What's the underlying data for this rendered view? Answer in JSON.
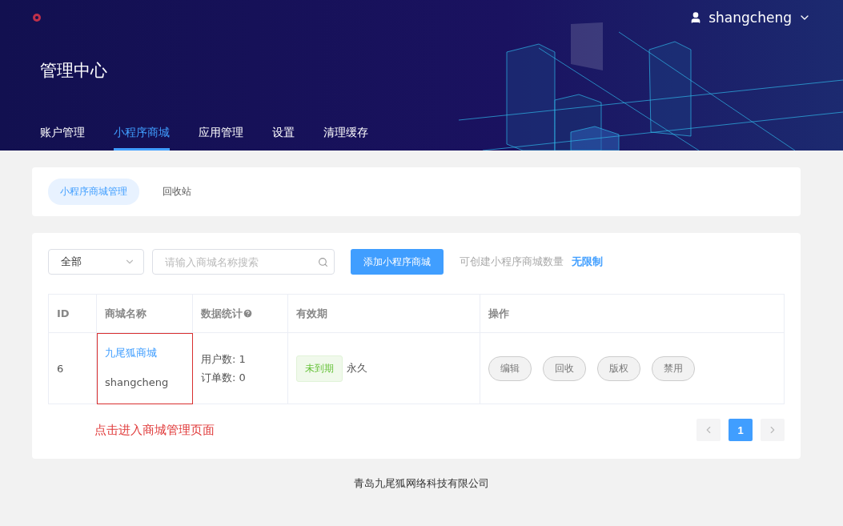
{
  "header": {
    "user": "shangcheng",
    "title": "管理中心",
    "nav": [
      {
        "label": "账户管理",
        "selected": false
      },
      {
        "label": "小程序商城",
        "selected": true
      },
      {
        "label": "应用管理",
        "selected": false
      },
      {
        "label": "设置",
        "selected": false
      },
      {
        "label": "清理缓存",
        "selected": false
      }
    ]
  },
  "subtabs": [
    {
      "label": "小程序商城管理",
      "selected": true
    },
    {
      "label": "回收站",
      "selected": false
    }
  ],
  "toolbar": {
    "filter": "全部",
    "search_placeholder": "请输入商城名称搜索",
    "add_button": "添加小程序商城",
    "quota_label": "可创建小程序商城数量",
    "quota_value": "无限制"
  },
  "table": {
    "columns": [
      "ID",
      "商城名称",
      "数据统计",
      "有效期",
      "操作"
    ],
    "rows": [
      {
        "id": "6",
        "name": "九尾狐商城",
        "account": "shangcheng",
        "stats": [
          "用户数: 1",
          "订单数: 0"
        ],
        "status": "未到期",
        "validity": "永久",
        "actions": [
          "编辑",
          "回收",
          "版权",
          "禁用"
        ],
        "highlighted": true
      }
    ]
  },
  "annotation": "点击进入商城管理页面",
  "pagination": {
    "pages": [
      {
        "label": "1",
        "selected": true
      }
    ]
  },
  "footer": "青岛九尾狐网络科技有限公司"
}
